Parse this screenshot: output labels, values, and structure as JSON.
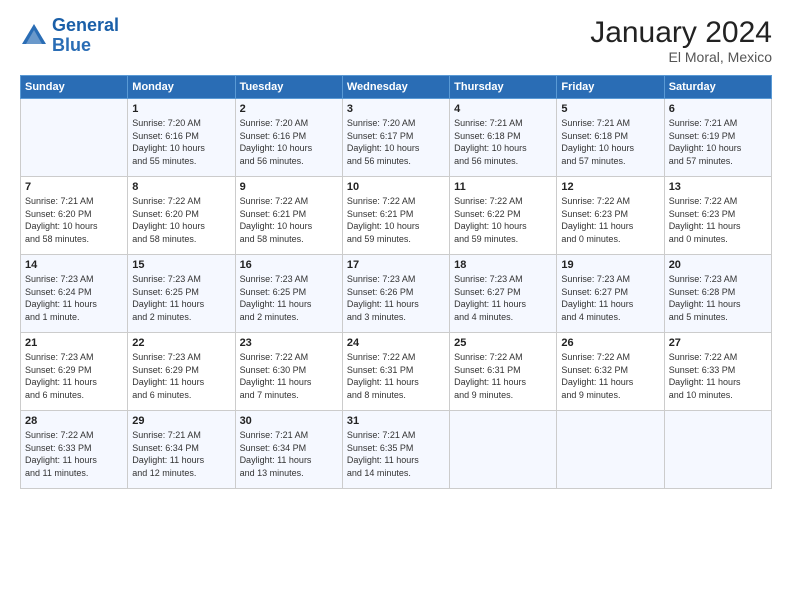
{
  "header": {
    "logo_line1": "General",
    "logo_line2": "Blue",
    "title": "January 2024",
    "subtitle": "El Moral, Mexico"
  },
  "columns": [
    "Sunday",
    "Monday",
    "Tuesday",
    "Wednesday",
    "Thursday",
    "Friday",
    "Saturday"
  ],
  "weeks": [
    [
      {
        "day": "",
        "info": ""
      },
      {
        "day": "1",
        "info": "Sunrise: 7:20 AM\nSunset: 6:16 PM\nDaylight: 10 hours\nand 55 minutes."
      },
      {
        "day": "2",
        "info": "Sunrise: 7:20 AM\nSunset: 6:16 PM\nDaylight: 10 hours\nand 56 minutes."
      },
      {
        "day": "3",
        "info": "Sunrise: 7:20 AM\nSunset: 6:17 PM\nDaylight: 10 hours\nand 56 minutes."
      },
      {
        "day": "4",
        "info": "Sunrise: 7:21 AM\nSunset: 6:18 PM\nDaylight: 10 hours\nand 56 minutes."
      },
      {
        "day": "5",
        "info": "Sunrise: 7:21 AM\nSunset: 6:18 PM\nDaylight: 10 hours\nand 57 minutes."
      },
      {
        "day": "6",
        "info": "Sunrise: 7:21 AM\nSunset: 6:19 PM\nDaylight: 10 hours\nand 57 minutes."
      }
    ],
    [
      {
        "day": "7",
        "info": "Sunrise: 7:21 AM\nSunset: 6:20 PM\nDaylight: 10 hours\nand 58 minutes."
      },
      {
        "day": "8",
        "info": "Sunrise: 7:22 AM\nSunset: 6:20 PM\nDaylight: 10 hours\nand 58 minutes."
      },
      {
        "day": "9",
        "info": "Sunrise: 7:22 AM\nSunset: 6:21 PM\nDaylight: 10 hours\nand 58 minutes."
      },
      {
        "day": "10",
        "info": "Sunrise: 7:22 AM\nSunset: 6:21 PM\nDaylight: 10 hours\nand 59 minutes."
      },
      {
        "day": "11",
        "info": "Sunrise: 7:22 AM\nSunset: 6:22 PM\nDaylight: 10 hours\nand 59 minutes."
      },
      {
        "day": "12",
        "info": "Sunrise: 7:22 AM\nSunset: 6:23 PM\nDaylight: 11 hours\nand 0 minutes."
      },
      {
        "day": "13",
        "info": "Sunrise: 7:22 AM\nSunset: 6:23 PM\nDaylight: 11 hours\nand 0 minutes."
      }
    ],
    [
      {
        "day": "14",
        "info": "Sunrise: 7:23 AM\nSunset: 6:24 PM\nDaylight: 11 hours\nand 1 minute."
      },
      {
        "day": "15",
        "info": "Sunrise: 7:23 AM\nSunset: 6:25 PM\nDaylight: 11 hours\nand 2 minutes."
      },
      {
        "day": "16",
        "info": "Sunrise: 7:23 AM\nSunset: 6:25 PM\nDaylight: 11 hours\nand 2 minutes."
      },
      {
        "day": "17",
        "info": "Sunrise: 7:23 AM\nSunset: 6:26 PM\nDaylight: 11 hours\nand 3 minutes."
      },
      {
        "day": "18",
        "info": "Sunrise: 7:23 AM\nSunset: 6:27 PM\nDaylight: 11 hours\nand 4 minutes."
      },
      {
        "day": "19",
        "info": "Sunrise: 7:23 AM\nSunset: 6:27 PM\nDaylight: 11 hours\nand 4 minutes."
      },
      {
        "day": "20",
        "info": "Sunrise: 7:23 AM\nSunset: 6:28 PM\nDaylight: 11 hours\nand 5 minutes."
      }
    ],
    [
      {
        "day": "21",
        "info": "Sunrise: 7:23 AM\nSunset: 6:29 PM\nDaylight: 11 hours\nand 6 minutes."
      },
      {
        "day": "22",
        "info": "Sunrise: 7:23 AM\nSunset: 6:29 PM\nDaylight: 11 hours\nand 6 minutes."
      },
      {
        "day": "23",
        "info": "Sunrise: 7:22 AM\nSunset: 6:30 PM\nDaylight: 11 hours\nand 7 minutes."
      },
      {
        "day": "24",
        "info": "Sunrise: 7:22 AM\nSunset: 6:31 PM\nDaylight: 11 hours\nand 8 minutes."
      },
      {
        "day": "25",
        "info": "Sunrise: 7:22 AM\nSunset: 6:31 PM\nDaylight: 11 hours\nand 9 minutes."
      },
      {
        "day": "26",
        "info": "Sunrise: 7:22 AM\nSunset: 6:32 PM\nDaylight: 11 hours\nand 9 minutes."
      },
      {
        "day": "27",
        "info": "Sunrise: 7:22 AM\nSunset: 6:33 PM\nDaylight: 11 hours\nand 10 minutes."
      }
    ],
    [
      {
        "day": "28",
        "info": "Sunrise: 7:22 AM\nSunset: 6:33 PM\nDaylight: 11 hours\nand 11 minutes."
      },
      {
        "day": "29",
        "info": "Sunrise: 7:21 AM\nSunset: 6:34 PM\nDaylight: 11 hours\nand 12 minutes."
      },
      {
        "day": "30",
        "info": "Sunrise: 7:21 AM\nSunset: 6:34 PM\nDaylight: 11 hours\nand 13 minutes."
      },
      {
        "day": "31",
        "info": "Sunrise: 7:21 AM\nSunset: 6:35 PM\nDaylight: 11 hours\nand 14 minutes."
      },
      {
        "day": "",
        "info": ""
      },
      {
        "day": "",
        "info": ""
      },
      {
        "day": "",
        "info": ""
      }
    ]
  ]
}
